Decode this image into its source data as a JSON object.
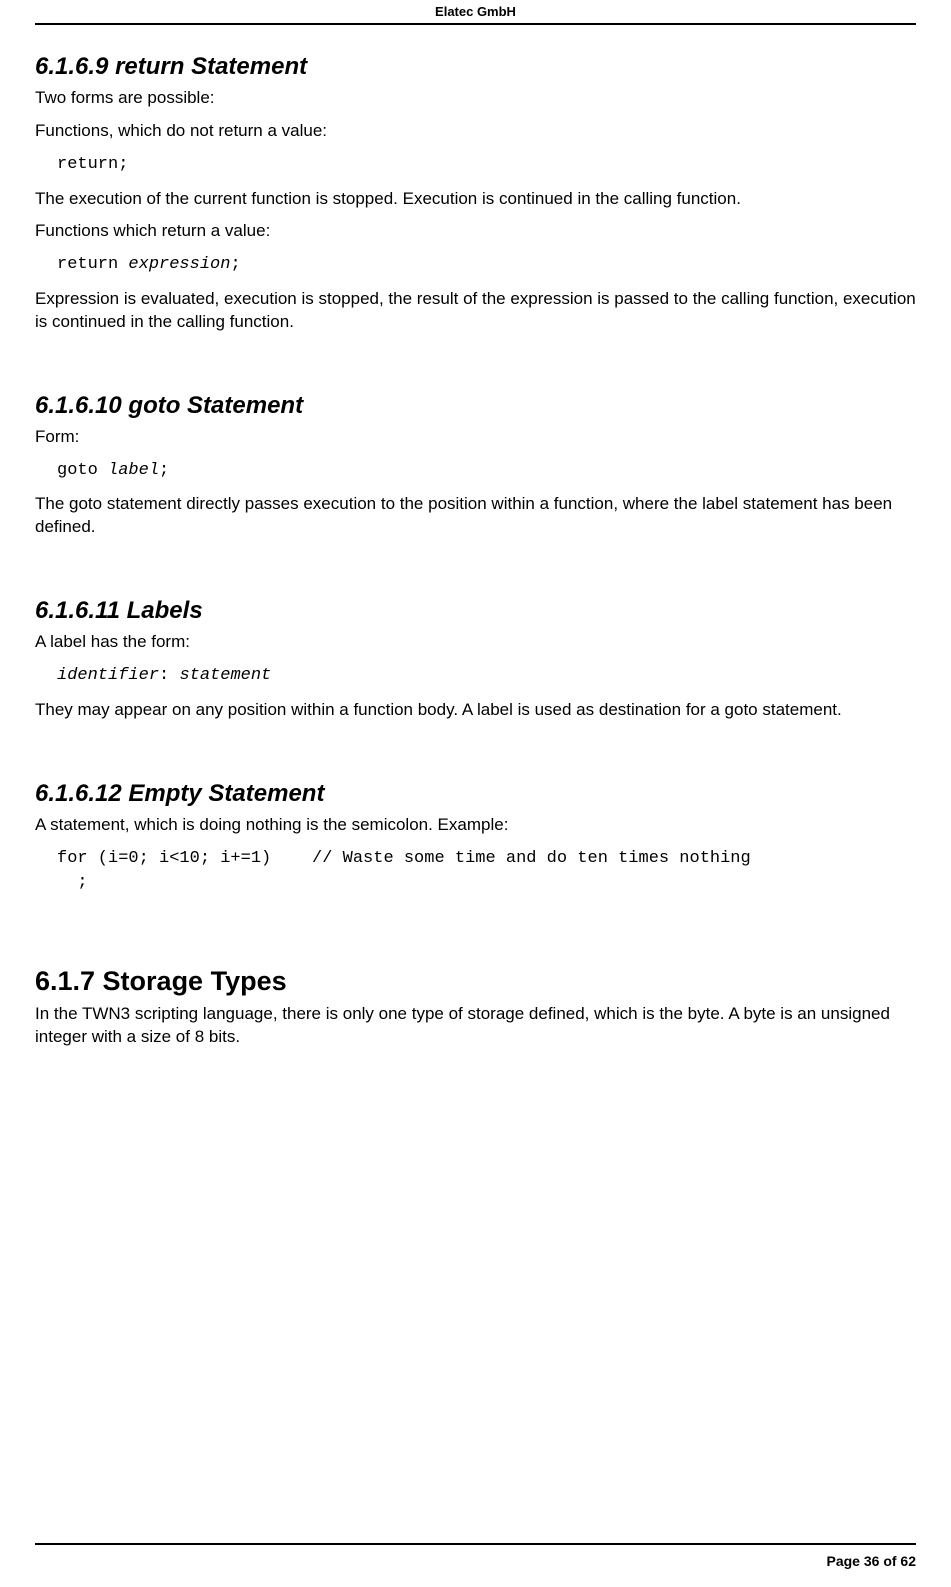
{
  "header": {
    "title": "Elatec GmbH"
  },
  "footer": {
    "text": "Page 36 of 62"
  },
  "sections": {
    "s0": {
      "heading": "6.1.6.9  return Statement",
      "p0": "Two forms are possible:",
      "p1": "Functions, which do not return a value:",
      "code0_kw": "return",
      "code0_tail": ";",
      "p2": "The execution of the current function is stopped. Execution is continued in the calling function.",
      "p3": "Functions which return a value:",
      "code1_kw": "return ",
      "code1_expr": "expression",
      "code1_tail": ";",
      "p4": "Expression is evaluated, execution is stopped, the result of the expression is passed to the calling function, execution is continued in the calling function."
    },
    "s1": {
      "heading": "6.1.6.10  goto Statement",
      "p0": "Form:",
      "code0_kw": "goto ",
      "code0_lbl": "label",
      "code0_tail": ";",
      "p1": "The goto statement directly passes execution to the position within a function, where the label statement has been defined."
    },
    "s2": {
      "heading": "6.1.6.11  Labels",
      "p0": "A label has the form:",
      "code0_id": "identifier",
      "code0_colon": ": ",
      "code0_stmt": "statement",
      "p1": "They may appear on any position within a function body. A label is used as destination for a goto statement."
    },
    "s3": {
      "heading": "6.1.6.12  Empty Statement",
      "p0": "A statement, which is doing nothing is the semicolon. Example:",
      "code0": "for (i=0; i<10; i+=1)    // Waste some time and do ten times nothing\n  ;"
    },
    "s4": {
      "heading": "6.1.7  Storage Types",
      "p0": "In the TWN3 scripting language, there is only one type of storage defined, which is the byte. A byte is an unsigned integer with a size of 8 bits."
    }
  }
}
